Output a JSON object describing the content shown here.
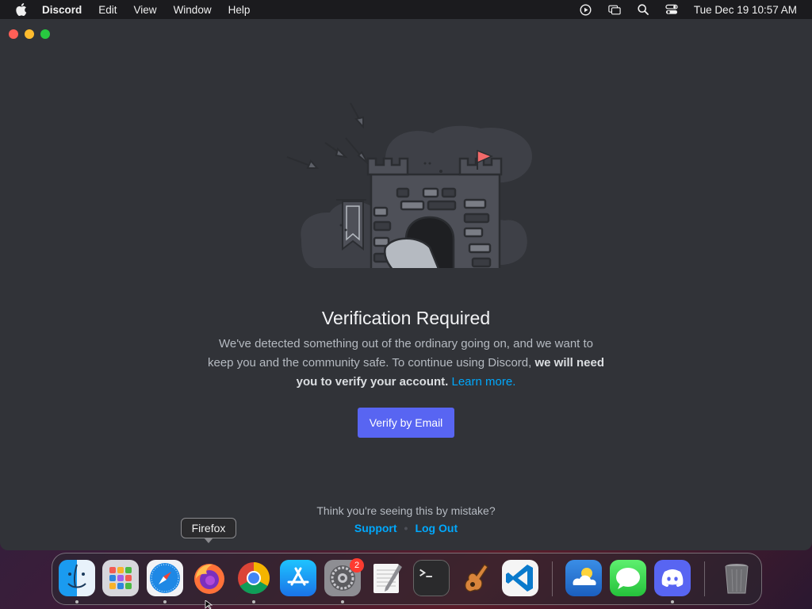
{
  "menubar": {
    "app_name": "Discord",
    "menus": [
      "Edit",
      "View",
      "Window",
      "Help"
    ],
    "clock": "Tue Dec 19  10:57 AM",
    "status_icons": [
      "screen-record-icon",
      "window-overview-icon",
      "spotlight-search-icon",
      "control-center-icon"
    ]
  },
  "page": {
    "title": "Verification Required",
    "desc_part1": "We've detected something out of the ordinary going on, and we want to keep you and the community safe. To continue using Discord, ",
    "desc_bold": "we will need you to verify your account.",
    "learn_more": "Learn more.",
    "verify_button": "Verify by Email",
    "mistake_text": "Think you're seeing this by mistake?",
    "support_link": "Support",
    "separator": "•",
    "logout_link": "Log Out"
  },
  "tooltip": {
    "label": "Firefox"
  },
  "dock": {
    "items": [
      {
        "name": "finder",
        "running": true
      },
      {
        "name": "launchpad",
        "running": false
      },
      {
        "name": "safari",
        "running": true
      },
      {
        "name": "firefox",
        "running": false
      },
      {
        "name": "chrome",
        "running": true
      },
      {
        "name": "app-store",
        "running": false
      },
      {
        "name": "system-settings",
        "running": true,
        "badge": "2"
      },
      {
        "name": "textedit",
        "running": false
      },
      {
        "name": "terminal",
        "running": false
      },
      {
        "name": "garageband",
        "running": false
      },
      {
        "name": "vscode",
        "running": false
      },
      {
        "name": "weather",
        "running": false
      },
      {
        "name": "messages",
        "running": false
      },
      {
        "name": "discord",
        "running": true
      },
      {
        "name": "trash",
        "running": false
      }
    ]
  },
  "colors": {
    "window_bg": "#313338",
    "brand": "#5865f2",
    "link": "#00a8fc",
    "flag": "#f26a6a"
  }
}
